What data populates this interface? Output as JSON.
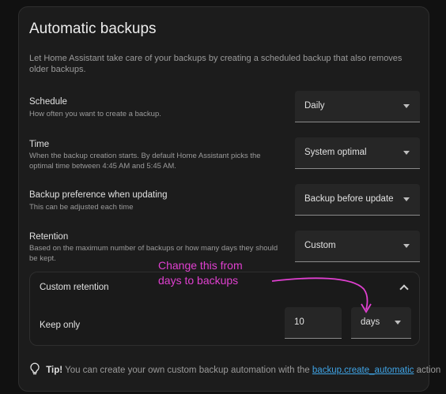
{
  "card": {
    "title": "Automatic backups",
    "description": "Let Home Assistant take care of your backups by creating a scheduled backup that also removes older backups."
  },
  "settings": [
    {
      "label": "Schedule",
      "sub": "How often you want to create a backup.",
      "value": "Daily"
    },
    {
      "label": "Time",
      "sub": "When the backup creation starts. By default Home Assistant picks the optimal time between 4:45 AM and 5:45 AM.",
      "value": "System optimal"
    },
    {
      "label": "Backup preference when updating",
      "sub": "This can be adjusted each time",
      "value": "Backup before update"
    },
    {
      "label": "Retention",
      "sub": "Based on the maximum number of backups or how many days they should be kept.",
      "value": "Custom"
    }
  ],
  "custom_retention": {
    "title": "Custom retention",
    "keep_label": "Keep only",
    "count": "10",
    "unit": "days"
  },
  "annotation": {
    "line1": "Change this from",
    "line2": "days to backups",
    "color": "#e040d0"
  },
  "tip": {
    "strong": "Tip!",
    "text_before": "You can create your own custom backup automation with the",
    "link": "backup.create_automatic",
    "text_after": "action"
  }
}
